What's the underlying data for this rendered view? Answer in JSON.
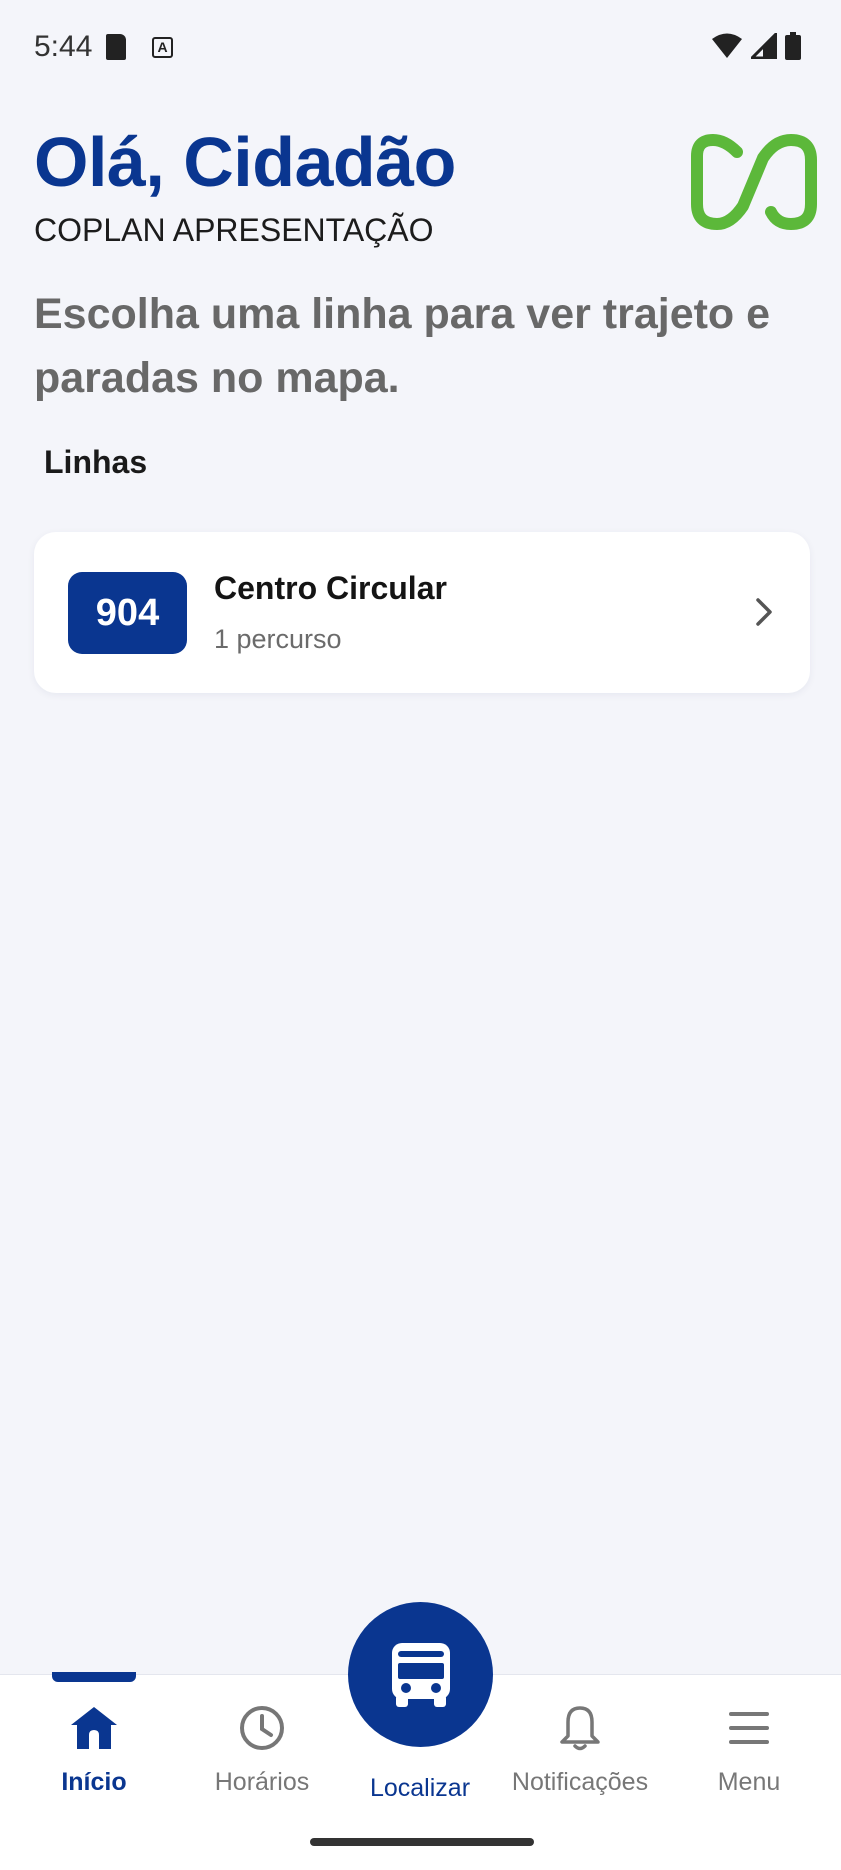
{
  "status_bar": {
    "time": "5:44",
    "icons": [
      "sd-card-icon",
      "keyboard-a-icon",
      "wifi-icon",
      "signal-icon",
      "battery-icon"
    ]
  },
  "header": {
    "greeting": "Olá, Cidadão",
    "organization": "COPLAN APRESENTAÇÃO"
  },
  "instruction": "Escolha uma linha para ver trajeto e paradas no mapa.",
  "section_title": "Linhas",
  "lines": [
    {
      "number": "904",
      "name": "Centro Circular",
      "routes": "1 percurso"
    }
  ],
  "bottom_nav": {
    "items": [
      {
        "label": "Início",
        "icon": "home-icon",
        "active": true
      },
      {
        "label": "Horários",
        "icon": "clock-icon",
        "active": false
      },
      {
        "label": "Localizar",
        "icon": "bus-icon",
        "active": false
      },
      {
        "label": "Notificações",
        "icon": "bell-icon",
        "active": false
      },
      {
        "label": "Menu",
        "icon": "menu-icon",
        "active": false
      }
    ]
  },
  "colors": {
    "primary": "#0a3690",
    "logo_green": "#5cb83a",
    "background": "#f4f5fa"
  }
}
